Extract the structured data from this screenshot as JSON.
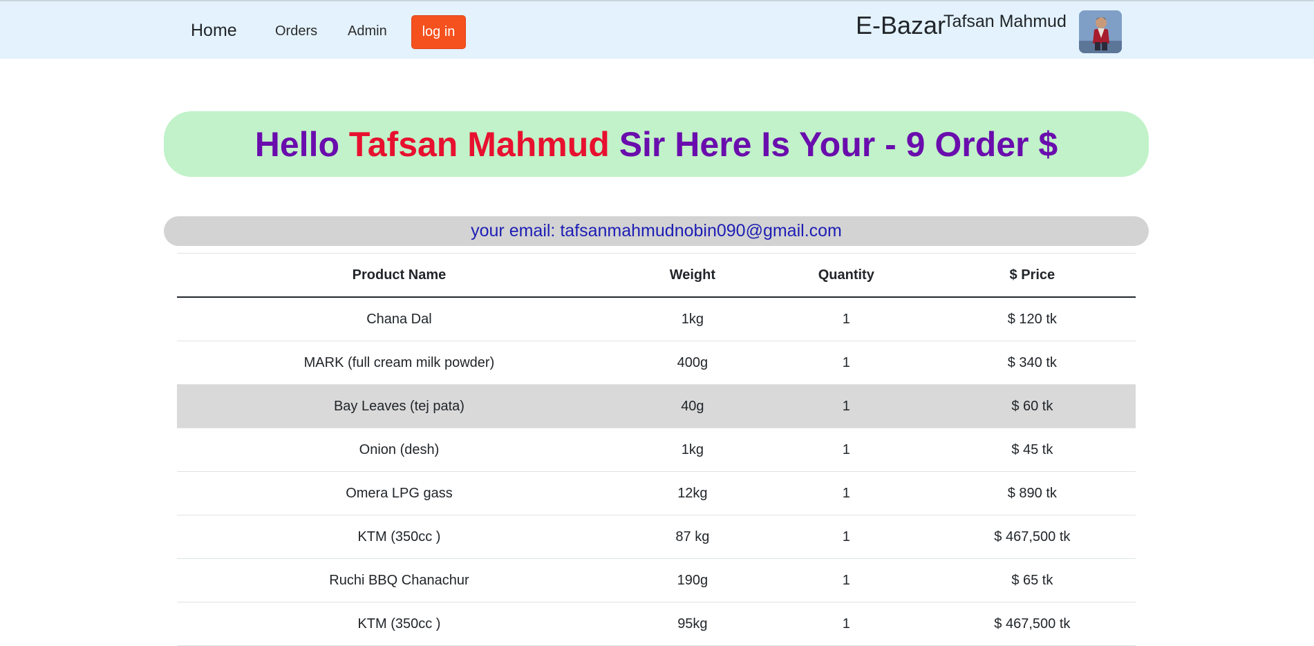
{
  "nav": {
    "home": "Home",
    "orders": "Orders",
    "admin": "Admin",
    "login": "log in",
    "brand": "E-Bazar",
    "user_name": "Tafsan Mahmud"
  },
  "banner": {
    "prefix": "Hello ",
    "name": "Tafsan Mahmud",
    "suffix": " Sir Here Is Your - 9 Order $"
  },
  "email_text": "your email: tafsanmahmudnobin090@gmail.com",
  "table": {
    "headers": [
      "Product Name",
      "Weight",
      "Quantity",
      "$ Price"
    ],
    "rows": [
      [
        "Chana Dal",
        "1kg",
        "1",
        "$ 120 tk"
      ],
      [
        "MARK (full cream milk powder)",
        "400g",
        "1",
        "$ 340 tk"
      ],
      [
        "Bay Leaves (tej pata)",
        "40g",
        "1",
        "$ 60 tk"
      ],
      [
        "Onion (desh)",
        "1kg",
        "1",
        "$ 45 tk"
      ],
      [
        "Omera LPG gass",
        "12kg",
        "1",
        "$ 890 tk"
      ],
      [
        "KTM (350cc )",
        "87 kg",
        "1",
        "$ 467,500 tk"
      ],
      [
        "Ruchi BBQ Chanachur",
        "190g",
        "1",
        "$ 65 tk"
      ],
      [
        "KTM (350cc )",
        "95kg",
        "1",
        "$ 467,500 tk"
      ]
    ]
  },
  "colors": {
    "navbar_bg": "#e3f2fd",
    "login_btn": "#f4511e",
    "banner_bg": "#c1f2c9",
    "banner_text": "#6a0dad",
    "banner_name": "#e8102f",
    "email_bg": "#d3d3d3",
    "email_text": "#1d1db5",
    "row_highlight": "#d9d9d9"
  }
}
